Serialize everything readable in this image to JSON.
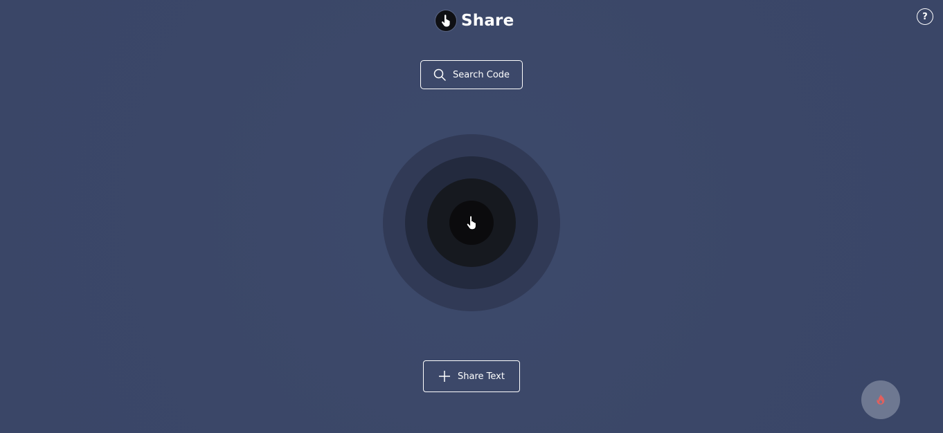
{
  "header": {
    "title": "Share",
    "logo_icon": "pointer-hand-icon"
  },
  "help": {
    "label": "?",
    "icon": "help-icon"
  },
  "search": {
    "label": "Search Code",
    "icon": "search-icon"
  },
  "radar": {
    "icon": "pointer-hand-icon"
  },
  "share": {
    "label": "Share Text",
    "icon": "plus-icon"
  },
  "fab": {
    "icon": "fire-icon",
    "color": "#e0605e"
  },
  "colors": {
    "background": "#3b4768",
    "ring_outer": "#313a56",
    "ring_middle": "#232a3e",
    "ring_inner": "#16191f",
    "ring_center": "#0b0b0d",
    "fab_background": "#6e7891",
    "accent": "#e0605e"
  }
}
